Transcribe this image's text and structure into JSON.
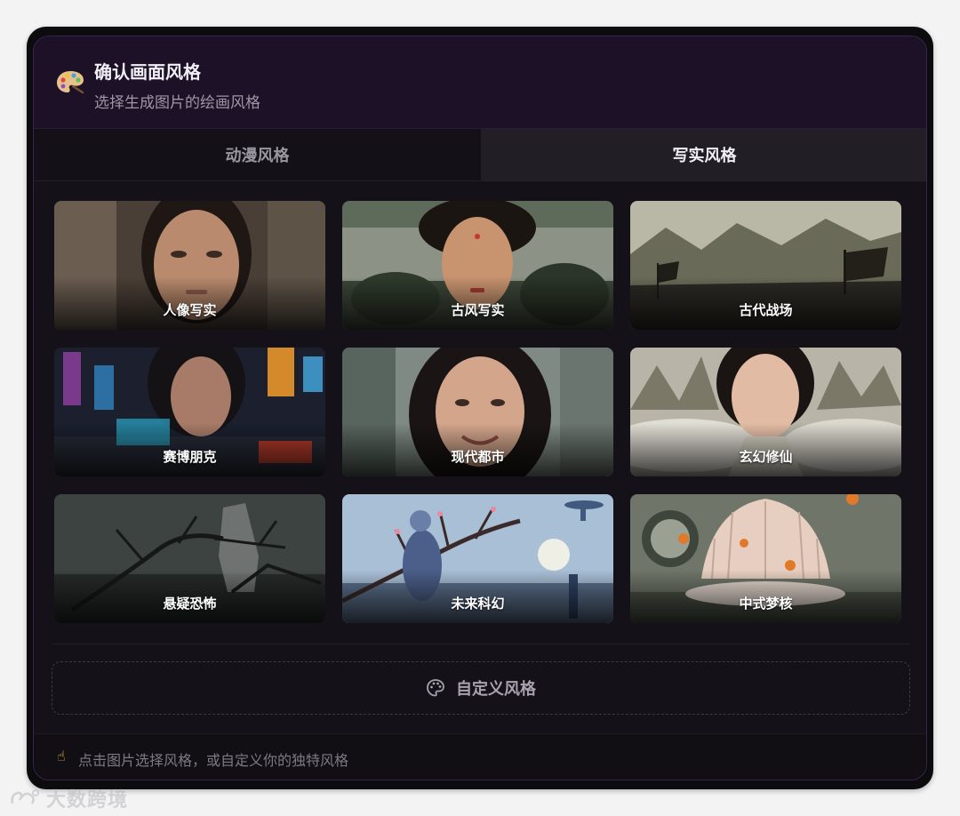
{
  "header": {
    "icon": "palette-icon",
    "title": "确认画面风格",
    "subtitle": "选择生成图片的绘画风格"
  },
  "tabs": [
    {
      "label": "动漫风格",
      "active": false
    },
    {
      "label": "写实风格",
      "active": true
    }
  ],
  "styles": [
    {
      "label": "人像写实",
      "icon": "portrait-photo-image"
    },
    {
      "label": "古风写实",
      "icon": "ancient-style-photo-image"
    },
    {
      "label": "古代战场",
      "icon": "ancient-battlefield-image"
    },
    {
      "label": "赛博朋克",
      "icon": "cyberpunk-image"
    },
    {
      "label": "现代都市",
      "icon": "modern-city-image"
    },
    {
      "label": "玄幻修仙",
      "icon": "fantasy-xianxia-image"
    },
    {
      "label": "悬疑恐怖",
      "icon": "horror-suspense-image"
    },
    {
      "label": "未来科幻",
      "icon": "scifi-future-image"
    },
    {
      "label": "中式梦核",
      "icon": "chinese-dreamcore-image"
    }
  ],
  "custom_button": {
    "label": "自定义风格",
    "icon": "palette-outline-icon"
  },
  "footer": {
    "icon": "pointing-hand-icon",
    "hint": "点击图片选择风格，或自定义你的独特风格"
  },
  "watermark": {
    "text": "大数跨境"
  },
  "colors": {
    "accent_border": "#3a2350",
    "header_bg": "#1c1127",
    "panel_bg": "#141218"
  }
}
